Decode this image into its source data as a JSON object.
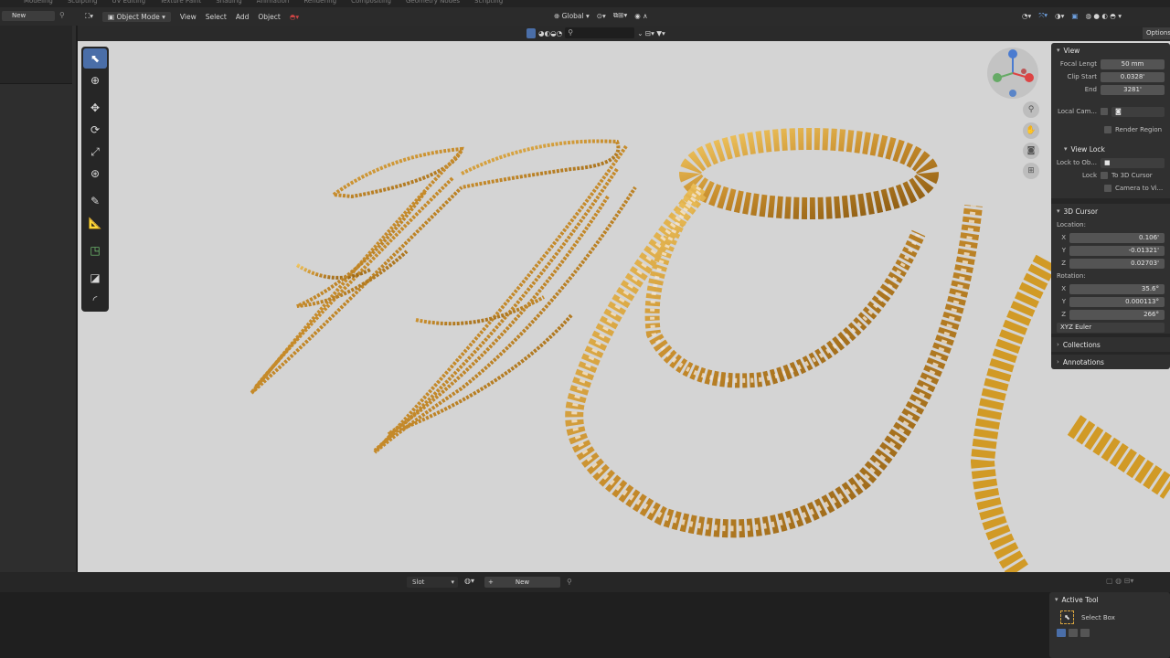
{
  "workspace_tabs": [
    "Modeling",
    "Sculpting",
    "UV Editing",
    "Texture Paint",
    "Shading",
    "Animation",
    "Rendering",
    "Compositing",
    "Geometry Nodes",
    "Scripting"
  ],
  "left_panel": {
    "new_label": "New"
  },
  "header": {
    "mode": "Object Mode",
    "menus": [
      "View",
      "Select",
      "Add",
      "Object"
    ],
    "orientation": "Global",
    "options_label": "Options"
  },
  "npanel": {
    "view": {
      "title": "View",
      "focal_length_label": "Focal Lengt",
      "focal_length": "50 mm",
      "clip_start_label": "Clip Start",
      "clip_start": "0.0328'",
      "clip_end_label": "End",
      "clip_end": "3281'",
      "local_camera_label": "Local Cam...",
      "render_region_label": "Render Region"
    },
    "view_lock": {
      "title": "View Lock",
      "lock_to_object_label": "Lock to Ob...",
      "lock_label": "Lock",
      "to_3d_cursor": "To 3D Cursor",
      "camera_to_view": "Camera to Vi..."
    },
    "cursor": {
      "title": "3D Cursor",
      "location_label": "Location:",
      "x": "0.106'",
      "y": "-0.01321'",
      "z": "0.02703'",
      "rotation_label": "Rotation:",
      "rx": "35.6°",
      "ry": "0.000113°",
      "rz": "266°",
      "rotation_mode": "XYZ Euler"
    },
    "collections": "Collections",
    "annotations": "Annotations"
  },
  "bottom": {
    "slot_label": "Slot",
    "new_label": "New",
    "active_tool_title": "Active Tool",
    "select_box": "Select Box"
  },
  "colors": {
    "viewport_bg": "#d4d4d4",
    "gold": "#c9952e",
    "accent": "#4a6ea8"
  }
}
